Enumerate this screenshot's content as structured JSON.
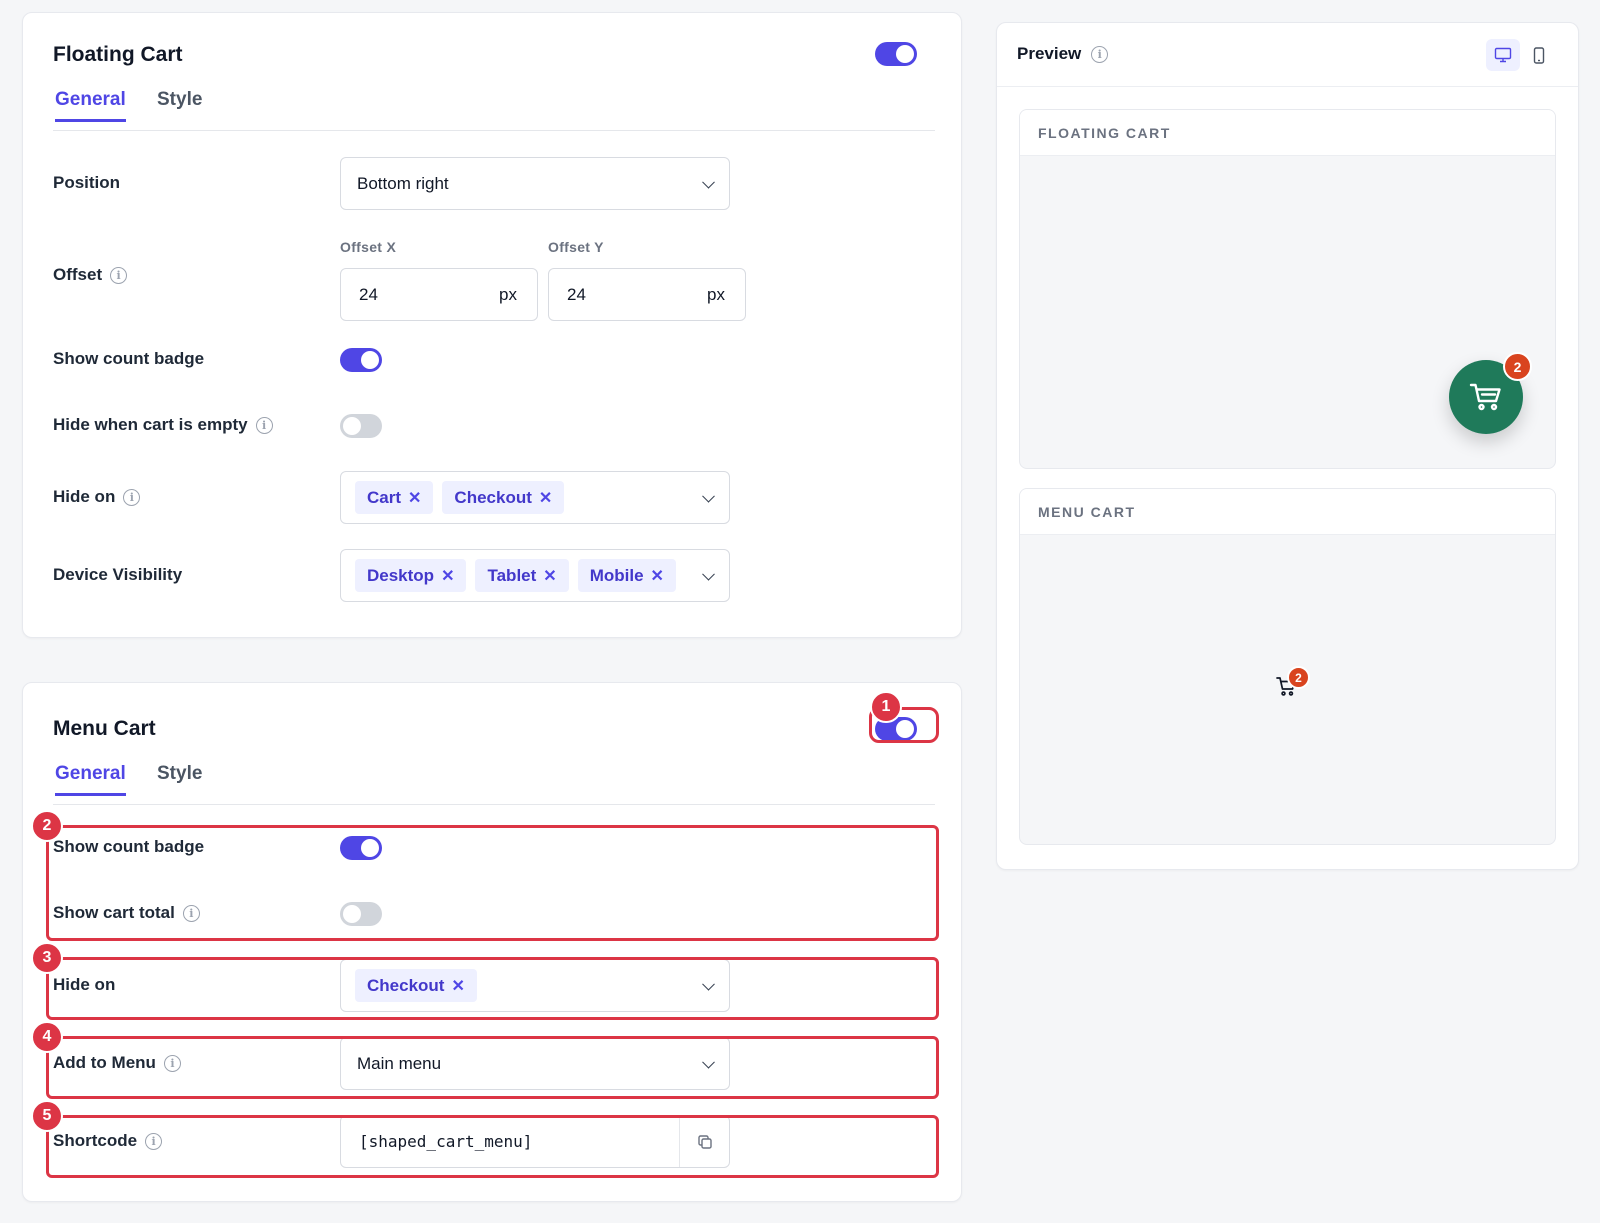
{
  "floating_cart": {
    "title": "Floating Cart",
    "enabled": true,
    "tabs": [
      "General",
      "Style"
    ],
    "active_tab": "General",
    "position": {
      "label": "Position",
      "value": "Bottom right"
    },
    "offset": {
      "label": "Offset",
      "x_label": "Offset X",
      "x_value": "24",
      "x_unit": "px",
      "y_label": "Offset Y",
      "y_value": "24",
      "y_unit": "px"
    },
    "show_count_badge": {
      "label": "Show count badge",
      "on": true
    },
    "hide_when_empty": {
      "label": "Hide when cart is empty",
      "on": false
    },
    "hide_on": {
      "label": "Hide on",
      "tags": [
        "Cart",
        "Checkout"
      ]
    },
    "device_visibility": {
      "label": "Device Visibility",
      "tags": [
        "Desktop",
        "Tablet",
        "Mobile"
      ]
    }
  },
  "menu_cart": {
    "title": "Menu Cart",
    "enabled": true,
    "tabs": [
      "General",
      "Style"
    ],
    "active_tab": "General",
    "show_count_badge": {
      "label": "Show count badge",
      "on": true
    },
    "show_cart_total": {
      "label": "Show cart total",
      "on": false
    },
    "hide_on": {
      "label": "Hide on",
      "tags": [
        "Checkout"
      ]
    },
    "add_to_menu": {
      "label": "Add to Menu",
      "value": "Main menu"
    },
    "shortcode": {
      "label": "Shortcode",
      "value": "[shaped_cart_menu]"
    }
  },
  "annotations": [
    "1",
    "2",
    "3",
    "4",
    "5"
  ],
  "preview": {
    "title": "Preview",
    "devices": [
      "desktop-icon",
      "mobile-icon"
    ],
    "active_device": "desktop",
    "floating_panel_label": "FLOATING CART",
    "menu_panel_label": "MENU CART",
    "floating_count": "2",
    "menu_count": "2"
  },
  "colors": {
    "accent": "#4f46e5",
    "highlight": "#dc3545",
    "fab": "#1f7a5a",
    "count_badge": "#d9441f"
  }
}
